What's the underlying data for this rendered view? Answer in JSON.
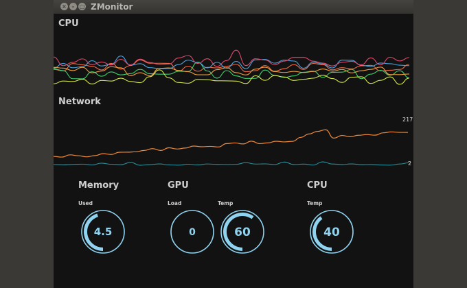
{
  "window": {
    "title": "ZMonitor",
    "buttons": {
      "close": "×",
      "minimize": "–",
      "maximize": "□"
    }
  },
  "cpu_graph": {
    "title": "CPU",
    "series_colors": [
      "#f06a45",
      "#3fd26b",
      "#4aa3e0",
      "#d6e64a",
      "#e04a6e",
      "#f0a040"
    ]
  },
  "network_graph": {
    "title": "Network",
    "max_label": "217",
    "min_label": "2",
    "series_colors": [
      "#f08a3a",
      "#2a8f9a"
    ]
  },
  "gauges": {
    "memory": {
      "title": "Memory",
      "used_label": "Used",
      "used_value": "4.5",
      "used_fraction": 0.45
    },
    "gpu": {
      "title": "GPU",
      "load_label": "Load",
      "load_value": "0",
      "load_fraction": 0,
      "temp_label": "Temp",
      "temp_value": "60",
      "temp_fraction": 0.6
    },
    "cpu": {
      "title": "CPU",
      "temp_label": "Temp",
      "temp_value": "40",
      "temp_fraction": 0.4
    }
  },
  "colors": {
    "gauge_ring": "#8fd3f0",
    "background": "#121212"
  }
}
